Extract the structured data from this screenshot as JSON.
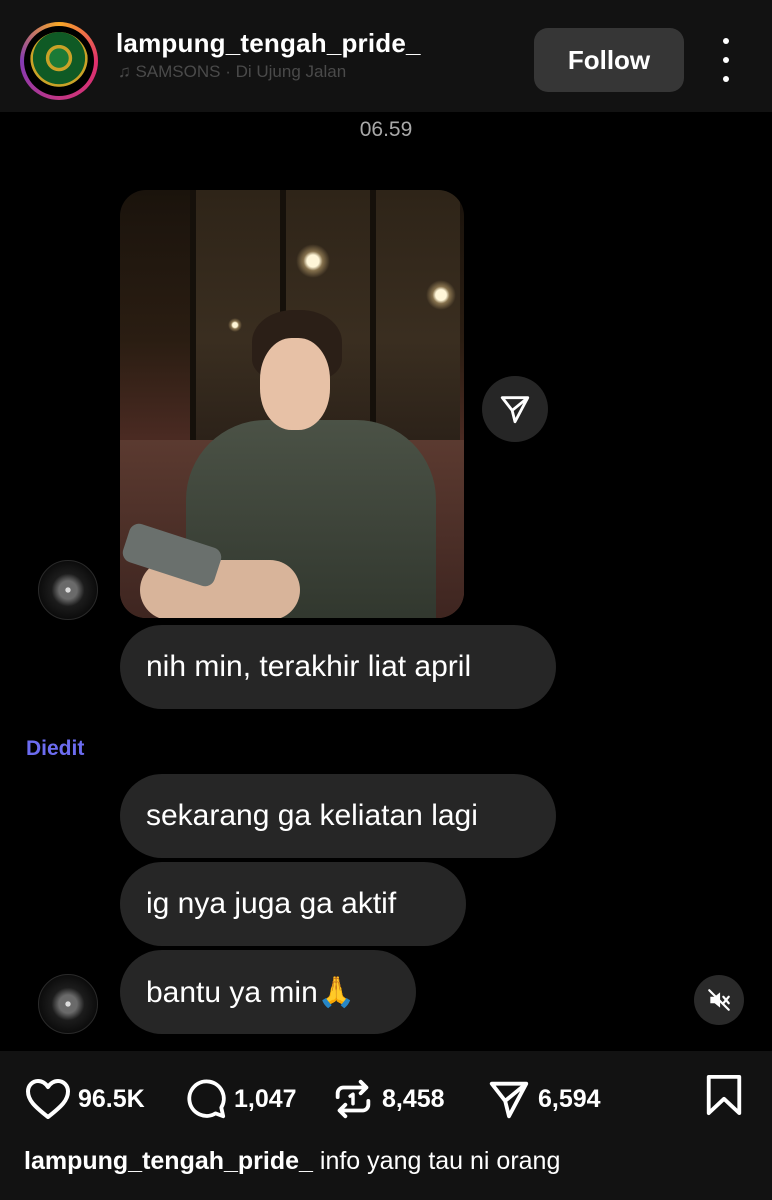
{
  "header": {
    "username": "lampung_tengah_pride_",
    "music": "♫ SAMSONS · Di Ujung Jalan",
    "follow_label": "Follow"
  },
  "chat": {
    "timestamp": "06.59",
    "edited_label": "Diedit",
    "messages": [
      "nih min, terakhir liat april",
      "sekarang ga keliatan lagi",
      "ig nya juga ga aktif",
      "bantu ya min🙏"
    ]
  },
  "footer": {
    "likes": "96.5K",
    "comments": "1,047",
    "reposts": "8,458",
    "shares": "6,594",
    "caption_user": "lampung_tengah_pride_",
    "caption_text": "info yang tau ni orang"
  },
  "icons": {
    "header": [
      "avatar",
      "more-icon"
    ],
    "chat": [
      "send-icon",
      "mute-icon"
    ],
    "footer": [
      "heart-icon",
      "comment-icon",
      "repost-icon",
      "send-icon",
      "bookmark-icon"
    ]
  },
  "colors": {
    "background": "#000000",
    "header_bg": "#121212",
    "bubble_bg": "#262626",
    "follow_btn_bg": "#363636",
    "edited_color": "#6c6cf0"
  }
}
